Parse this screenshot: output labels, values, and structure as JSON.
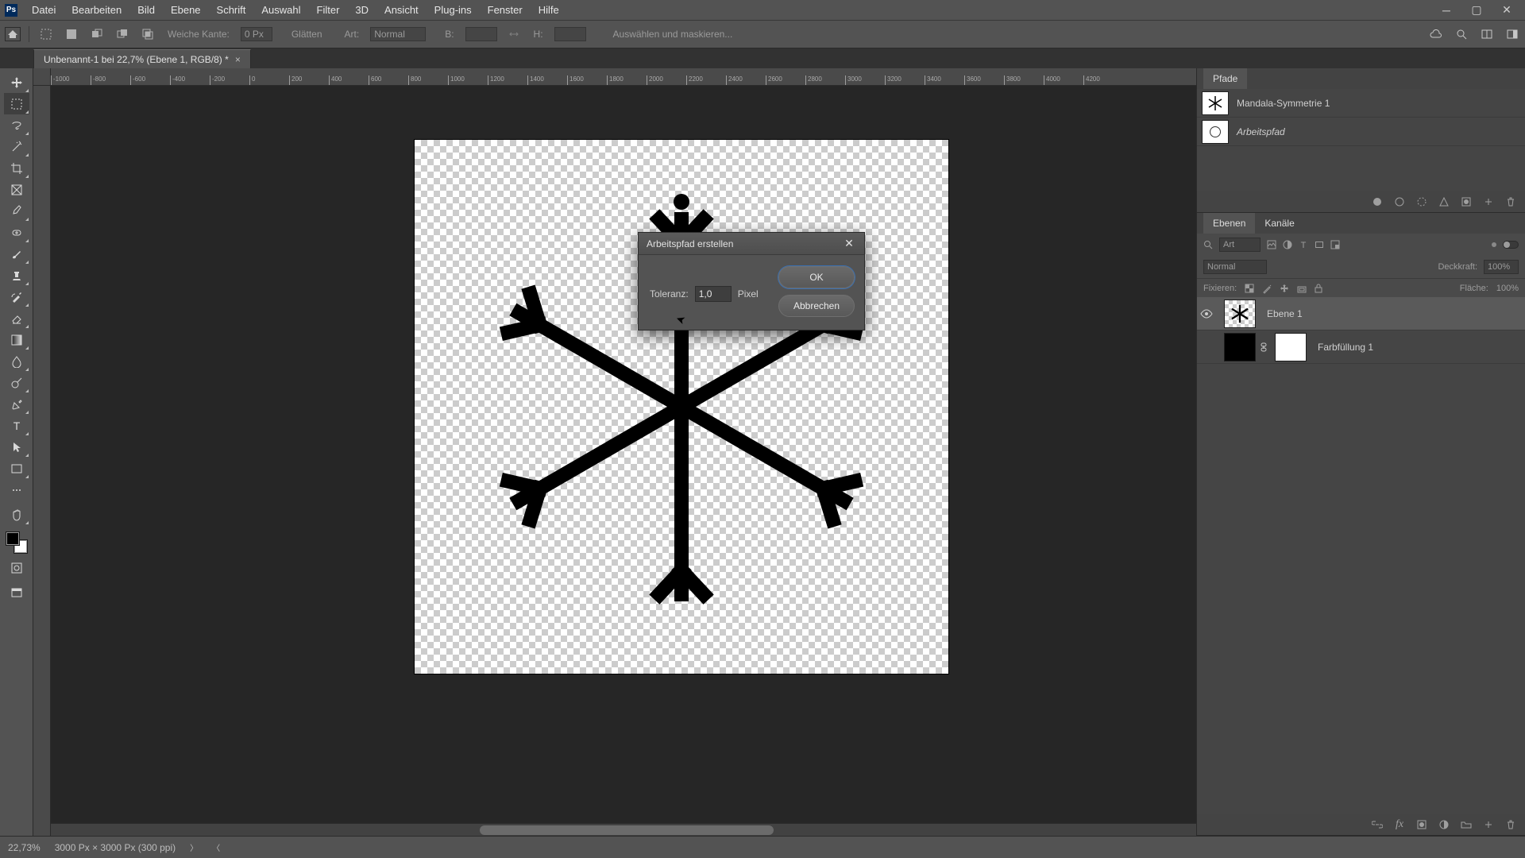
{
  "menu": {
    "items": [
      "Datei",
      "Bearbeiten",
      "Bild",
      "Ebene",
      "Schrift",
      "Auswahl",
      "Filter",
      "3D",
      "Ansicht",
      "Plug-ins",
      "Fenster",
      "Hilfe"
    ]
  },
  "optbar": {
    "weiche": "Weiche Kante:",
    "weiche_val": "0 Px",
    "glatt": "Glätten",
    "art": "Art:",
    "art_val": "Normal",
    "b": "B:",
    "h": "H:",
    "ausw": "Auswählen und maskieren..."
  },
  "tab": {
    "title": "Unbenannt-1 bei 22,7% (Ebene 1, RGB/8) *"
  },
  "ruler_marks": [
    "-1000",
    "-800",
    "-600",
    "-400",
    "-200",
    "0",
    "200",
    "400",
    "600",
    "800",
    "1000",
    "1200",
    "1400",
    "1600",
    "1800",
    "2000",
    "2200",
    "2400",
    "2600",
    "2800",
    "3000",
    "3200",
    "3400",
    "3600",
    "3800",
    "4000",
    "4200"
  ],
  "dialog": {
    "title": "Arbeitspfad erstellen",
    "tol_label": "Toleranz:",
    "tol_val": "1,0",
    "tol_unit": "Pixel",
    "ok": "OK",
    "cancel": "Abbrechen"
  },
  "paths_panel": {
    "tab": "Pfade",
    "rows": [
      {
        "name": "Mandala-Symmetrie 1",
        "thumb": "flake"
      },
      {
        "name": "Arbeitspfad",
        "thumb": "circle",
        "italic": true
      }
    ]
  },
  "layers_panel": {
    "tabs": [
      "Ebenen",
      "Kanäle"
    ],
    "active": 0,
    "filter": "Art",
    "blend": "Normal",
    "opacity_label": "Deckkraft:",
    "opacity": "100%",
    "lock_label": "Fixieren:",
    "fill_label": "Fläche:",
    "fill": "100%",
    "rows": [
      {
        "name": "Ebene 1",
        "visible": true,
        "selected": true,
        "thumb": "flake"
      },
      {
        "name": "Farbfüllung 1",
        "visible": false,
        "selected": false,
        "thumb": "fill"
      }
    ]
  },
  "status": {
    "zoom": "22,73%",
    "docinfo": "3000 Px × 3000 Px (300 ppi)"
  }
}
